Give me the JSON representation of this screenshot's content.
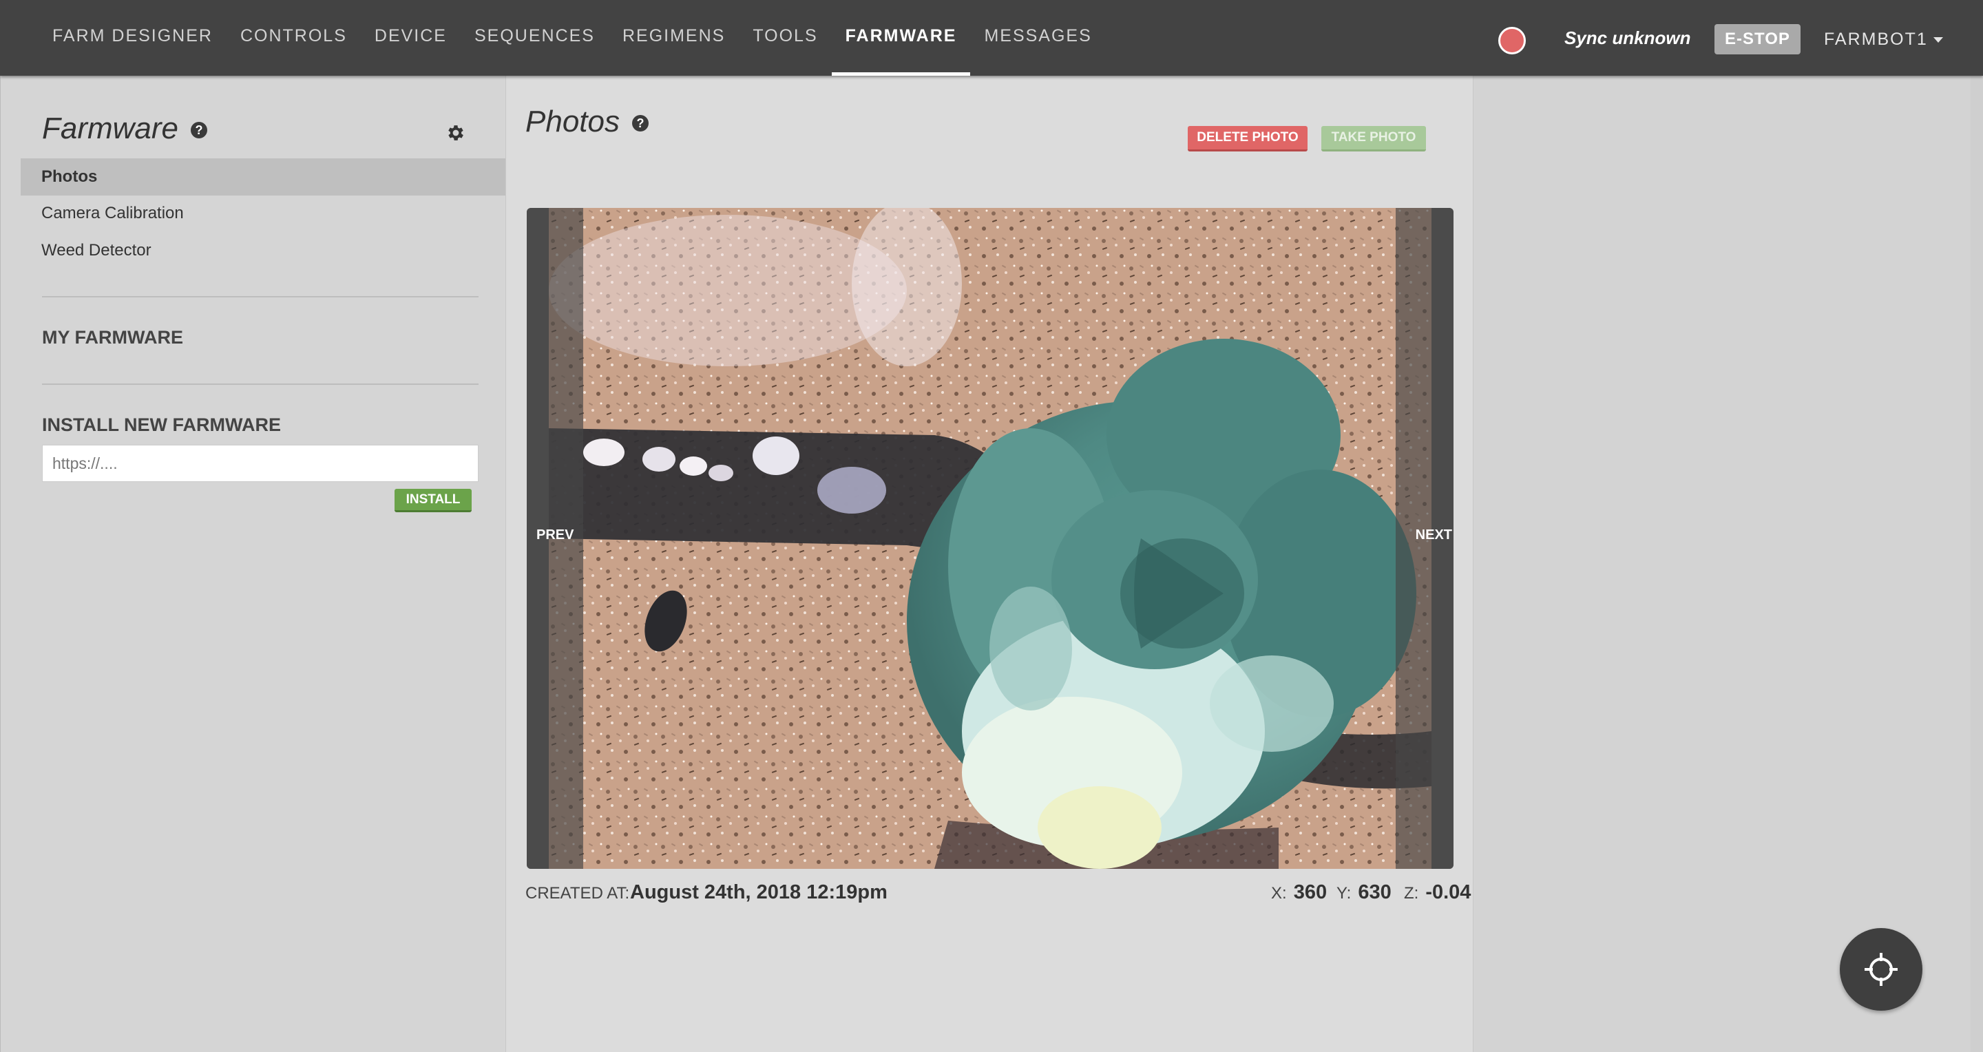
{
  "nav": {
    "items": [
      {
        "label": "FARM DESIGNER",
        "name": "nav-farm-designer",
        "active": false
      },
      {
        "label": "CONTROLS",
        "name": "nav-controls",
        "active": false
      },
      {
        "label": "DEVICE",
        "name": "nav-device",
        "active": false
      },
      {
        "label": "SEQUENCES",
        "name": "nav-sequences",
        "active": false
      },
      {
        "label": "REGIMENS",
        "name": "nav-regimens",
        "active": false
      },
      {
        "label": "TOOLS",
        "name": "nav-tools",
        "active": false
      },
      {
        "label": "FARMWARE",
        "name": "nav-farmware",
        "active": true
      },
      {
        "label": "MESSAGES",
        "name": "nav-messages",
        "active": false
      }
    ],
    "sync_status": "Sync unknown",
    "estop_label": "E-STOP",
    "account_label": "FARMBOT1",
    "status_color": "#e06666"
  },
  "sidebar": {
    "title": "Farmware",
    "help_glyph": "?",
    "menu": [
      {
        "label": "Photos",
        "active": true
      },
      {
        "label": "Camera Calibration",
        "active": false
      },
      {
        "label": "Weed Detector",
        "active": false
      }
    ],
    "my_farmware_heading": "MY FARMWARE",
    "install_heading": "INSTALL NEW FARMWARE",
    "url_placeholder": "https://....",
    "install_label": "INSTALL"
  },
  "photos": {
    "title": "Photos",
    "help_glyph": "?",
    "delete_label": "DELETE PHOTO",
    "take_label": "TAKE PHOTO",
    "prev_label": "PREV",
    "next_label": "NEXT",
    "created_label": "CREATED AT:",
    "created_value": "August 24th, 2018 12:19pm",
    "x_label": "X:",
    "x_value": "360",
    "y_label": "Y:",
    "y_value": "630",
    "z_label": "Z:",
    "z_value": "-0.04"
  },
  "colors": {
    "topbar": "#434343",
    "delete": "#e06666",
    "install": "#6ba34a",
    "take_disabled": "#a8c99a"
  },
  "icons": {
    "help": "help-icon",
    "settings": "gear-icon",
    "dropdown": "chevron-down-icon",
    "fab": "crosshair-icon"
  }
}
